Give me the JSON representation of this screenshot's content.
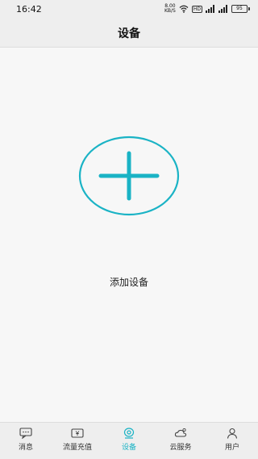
{
  "status_bar": {
    "time": "16:42",
    "net_speed_value": "8.00",
    "net_speed_unit": "KB/S",
    "hd_badge": "HD",
    "battery_level": "95"
  },
  "header": {
    "title": "设备"
  },
  "main": {
    "add_device_label": "添加设备",
    "accent_color": "#1ab3c5"
  },
  "tabs": [
    {
      "label": "消息",
      "icon": "message-icon",
      "active": false
    },
    {
      "label": "流量充值",
      "icon": "recharge-icon",
      "active": false
    },
    {
      "label": "设备",
      "icon": "device-icon",
      "active": true
    },
    {
      "label": "云服务",
      "icon": "cloud-icon",
      "active": false
    },
    {
      "label": "用户",
      "icon": "user-icon",
      "active": false
    }
  ]
}
